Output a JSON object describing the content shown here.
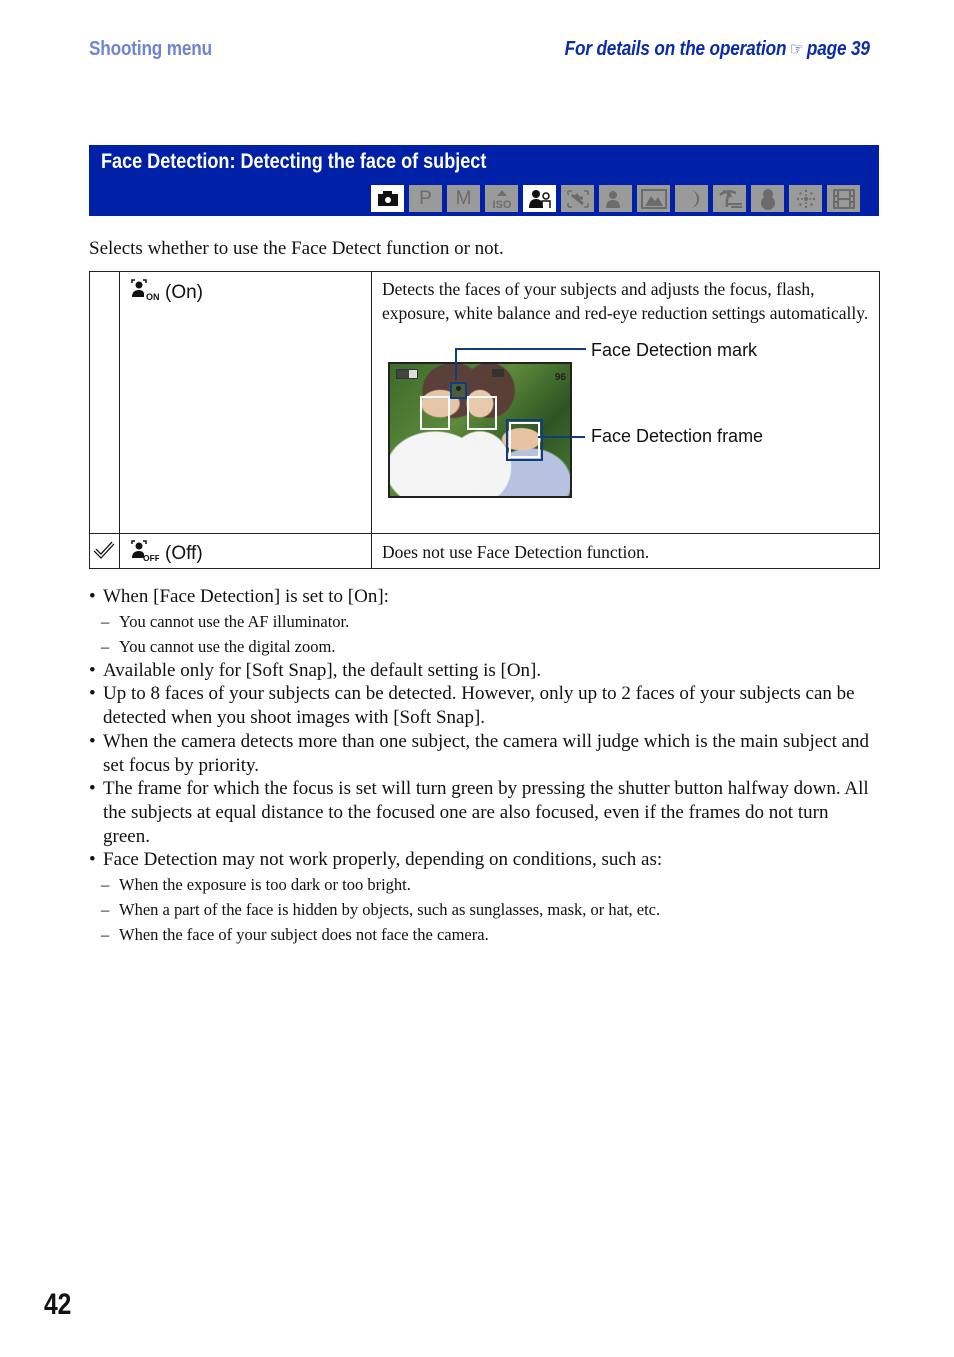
{
  "header": {
    "section": "Shooting menu",
    "reference_prefix": "For details on the operation",
    "reference_icon": "pointing-hand-icon",
    "reference_page": "page 39"
  },
  "banner": {
    "title": "Face Detection: Detecting the face of subject",
    "modes": [
      {
        "name": "auto",
        "icon": "camera-icon",
        "label": "",
        "active": true
      },
      {
        "name": "program",
        "icon": "program-p-icon",
        "label": "P",
        "active": false
      },
      {
        "name": "manual",
        "icon": "manual-m-icon",
        "label": "M",
        "active": false
      },
      {
        "name": "high-sensitivity",
        "icon": "iso-icon",
        "label": "ISO",
        "active": false
      },
      {
        "name": "soft-snap",
        "icon": "soft-snap-icon",
        "label": "",
        "active": true
      },
      {
        "name": "anti-blur",
        "icon": "anti-blur-icon",
        "label": "",
        "active": false
      },
      {
        "name": "twilight-portrait",
        "icon": "twilight-portrait-icon",
        "label": "",
        "active": false
      },
      {
        "name": "landscape",
        "icon": "landscape-icon",
        "label": "",
        "active": false
      },
      {
        "name": "twilight",
        "icon": "moon-icon",
        "label": "",
        "active": false
      },
      {
        "name": "beach",
        "icon": "beach-icon",
        "label": "",
        "active": false
      },
      {
        "name": "snow",
        "icon": "snowman-icon",
        "label": "",
        "active": false
      },
      {
        "name": "fireworks",
        "icon": "fireworks-icon",
        "label": "",
        "active": false
      },
      {
        "name": "movie",
        "icon": "film-icon",
        "label": "",
        "active": false
      }
    ]
  },
  "intro": "Selects whether to use the Face Detect function or not.",
  "options": [
    {
      "icon": "face-detection-on-icon",
      "icon_sub": "ON",
      "label": "(On)",
      "default": false,
      "description": "Detects the faces of your subjects and adjusts the focus, flash, exposure, white balance and red-eye reduction settings automatically.",
      "figure": {
        "osd_shots_remaining": "96",
        "callout_mark": "Face Detection mark",
        "callout_frame": "Face Detection frame"
      }
    },
    {
      "icon": "face-detection-off-icon",
      "icon_sub": "OFF",
      "label": "(Off)",
      "default": true,
      "default_icon": "checkmark-icon",
      "description": "Does not use Face Detection function."
    }
  ],
  "notes": [
    {
      "type": "bullet",
      "text": "When [Face Detection] is set to [On]:"
    },
    {
      "type": "dash",
      "text": "You cannot use the AF illuminator."
    },
    {
      "type": "dash",
      "text": "You cannot use the digital zoom."
    },
    {
      "type": "bullet",
      "text": "Available only for [Soft Snap], the default setting is [On]."
    },
    {
      "type": "bullet",
      "text": "Up to 8 faces of your subjects can be detected. However, only up to 2 faces of your subjects can be detected when you shoot images with [Soft Snap]."
    },
    {
      "type": "bullet",
      "text": "When the camera detects more than one subject, the camera will judge which is the main subject and set focus by priority."
    },
    {
      "type": "bullet",
      "text": "The frame for which the focus is set will turn green by pressing the shutter button halfway down. All the subjects at equal distance to the focused one are also focused, even if the frames do not turn green."
    },
    {
      "type": "bullet",
      "text": "Face Detection may not work properly, depending on conditions, such as:"
    },
    {
      "type": "dash",
      "text": "When the exposure is too dark or too bright."
    },
    {
      "type": "dash",
      "text": "When a part of the face is hidden by objects, such as sunglasses, mask, or hat, etc."
    },
    {
      "type": "dash",
      "text": "When the face of your subject does not face the camera."
    }
  ],
  "page_number": "42"
}
